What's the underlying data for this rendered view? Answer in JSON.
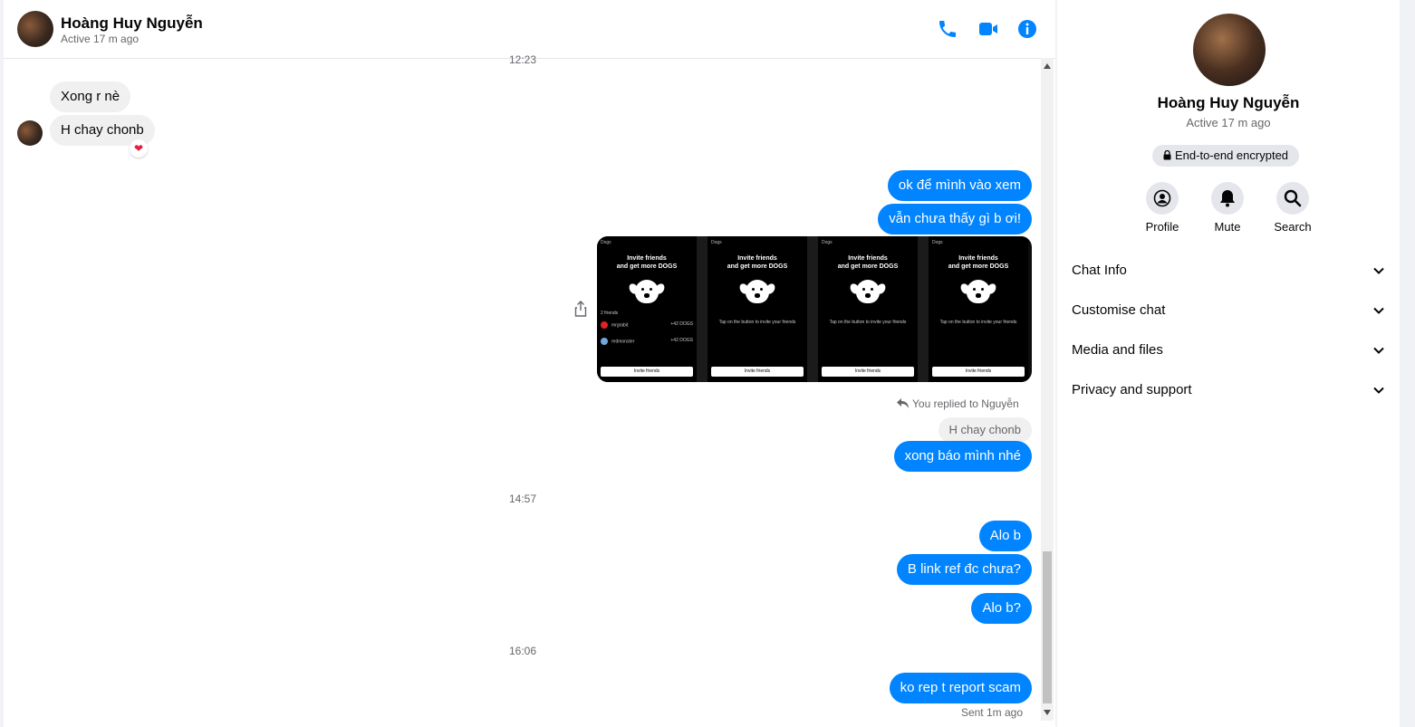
{
  "contact": {
    "name": "Hoàng Huy Nguyễn",
    "status": "Active 17 m ago"
  },
  "header_icons": [
    "phone-icon",
    "video-icon",
    "info-icon"
  ],
  "timestamps": {
    "t1": "12:23",
    "t2": "14:57",
    "t3": "16:06"
  },
  "messages": {
    "in1": "Xong r nè",
    "in2": "H chay chonb",
    "reaction": "❤",
    "out1": "ok để mình vào xem",
    "out2": "vẫn chưa thấy gì b ơi!",
    "replied_note": "You replied to Nguyễn",
    "quoted": "H chay chonb",
    "out3": "xong báo mình nhé",
    "out4": "Alo b",
    "out5": "B link ref đc chưa?",
    "out6": "Alo b?",
    "out7": "ko rep t report scam",
    "sent_note": "Sent 1m ago"
  },
  "screens": {
    "app": "Dogs",
    "title_line1": "Invite friends",
    "title_line2": "and get more DOGS",
    "hint": "Tap on the button to invite your friends",
    "button": "Invite friends",
    "friends_count": "2 friends",
    "friend1": "mrgrabit",
    "friend1_reward": "+42 DOGS",
    "friend2": "redmonster",
    "friend2_reward": "+42 DOGS"
  },
  "sidebar": {
    "encryption": "End-to-end encrypted",
    "actions": {
      "profile": "Profile",
      "mute": "Mute",
      "search": "Search"
    },
    "sections": {
      "chat_info": "Chat Info",
      "customise": "Customise chat",
      "media": "Media and files",
      "privacy": "Privacy and support"
    }
  },
  "colors": {
    "accent": "#0084ff",
    "incoming": "#f0f0f0",
    "reaction": "#e41e3f"
  }
}
